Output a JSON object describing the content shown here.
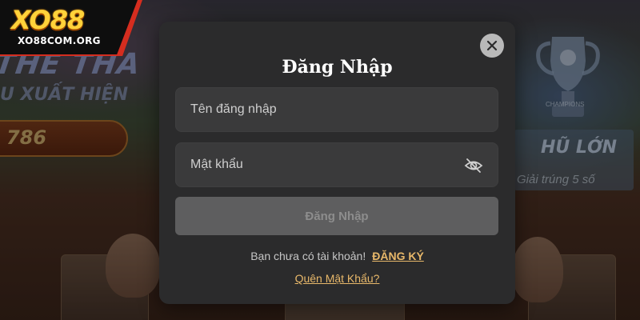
{
  "brand": {
    "logo_text": "XO88",
    "site_label": "XO88COM.ORG"
  },
  "background": {
    "headline": "THỂ THA",
    "subheadline": "U XUẤT HIỆN",
    "counter": "786",
    "jackpot_title": "HŨ LỚN",
    "jackpot_subtitle": "Giải trúng 5 số",
    "trophy_label": "CHAMPIONS"
  },
  "login_modal": {
    "title": "Đăng Nhập",
    "username_placeholder": "Tên đăng nhập",
    "password_placeholder": "Mật khẩu",
    "submit_label": "Đăng Nhập",
    "no_account_text": "Bạn chưa có tài khoản!",
    "register_link": "ĐĂNG KÝ",
    "forgot_password_link": "Quên Mật Khẩu?"
  },
  "icons": {
    "close": "close-icon",
    "password_visibility": "eye-off-icon"
  },
  "colors": {
    "modal_background": "#2b2b2c",
    "input_background": "#3a3a3b",
    "button_disabled": "#5e5e5f",
    "link_gold": "#e8b86a",
    "logo_yellow": "#ffd23a",
    "logo_red": "#d52d1f"
  }
}
